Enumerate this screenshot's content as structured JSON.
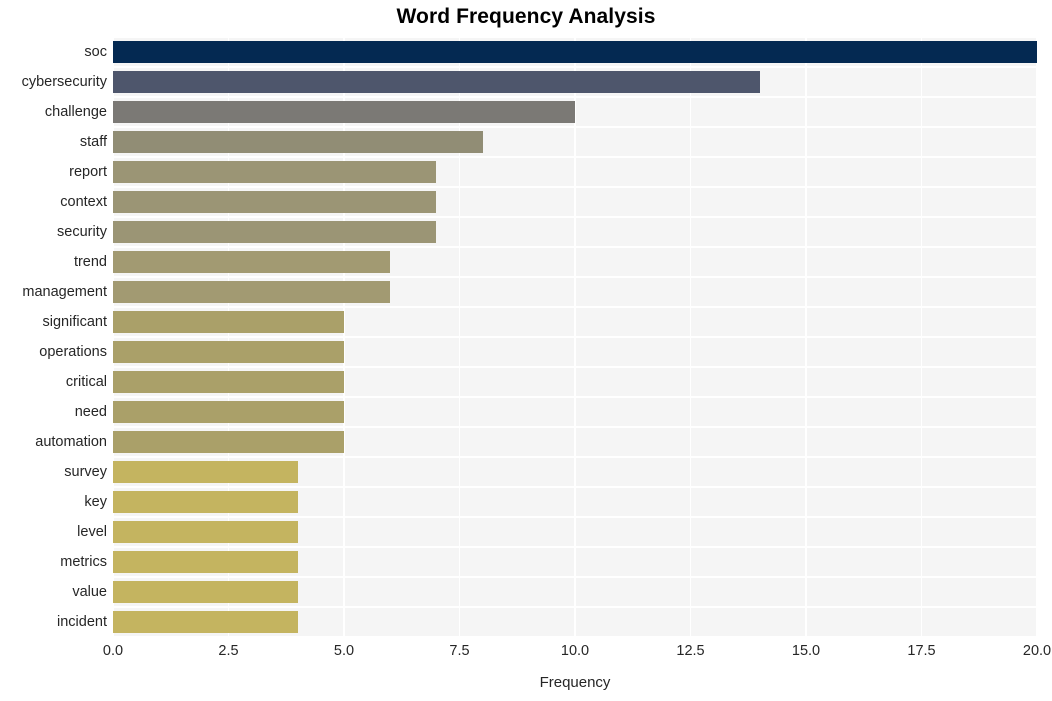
{
  "chart_data": {
    "type": "bar",
    "orientation": "horizontal",
    "title": "Word Frequency Analysis",
    "xlabel": "Frequency",
    "ylabel": "",
    "xlim": [
      0.0,
      20.0
    ],
    "grid": true,
    "legend": "none",
    "xticks": [
      "0.0",
      "2.5",
      "5.0",
      "7.5",
      "10.0",
      "12.5",
      "15.0",
      "17.5",
      "20.0"
    ],
    "xtick_values": [
      0.0,
      2.5,
      5.0,
      7.5,
      10.0,
      12.5,
      15.0,
      17.5,
      20.0
    ],
    "categories": [
      "soc",
      "cybersecurity",
      "challenge",
      "staff",
      "report",
      "context",
      "security",
      "trend",
      "management",
      "significant",
      "operations",
      "critical",
      "need",
      "automation",
      "survey",
      "key",
      "level",
      "metrics",
      "value",
      "incident"
    ],
    "values": [
      20,
      14,
      10,
      8,
      7,
      7,
      7,
      6,
      6,
      5,
      5,
      5,
      5,
      5,
      4,
      4,
      4,
      4,
      4,
      4
    ],
    "bar_colors": [
      "#042952",
      "#4e566c",
      "#7b7975",
      "#918d75",
      "#9b9575",
      "#9b9575",
      "#9b9575",
      "#a29a72",
      "#a29a72",
      "#aaa069",
      "#aaa069",
      "#aaa069",
      "#aaa069",
      "#aaa069",
      "#c4b460",
      "#c4b460",
      "#c4b460",
      "#c4b460",
      "#c4b460",
      "#c4b460"
    ]
  },
  "style": {
    "panel_background": "#f5f5f5",
    "figure_background": "#ffffff",
    "grid_color": "#ffffff",
    "text_color": "#262626",
    "title_color": "#000000"
  }
}
